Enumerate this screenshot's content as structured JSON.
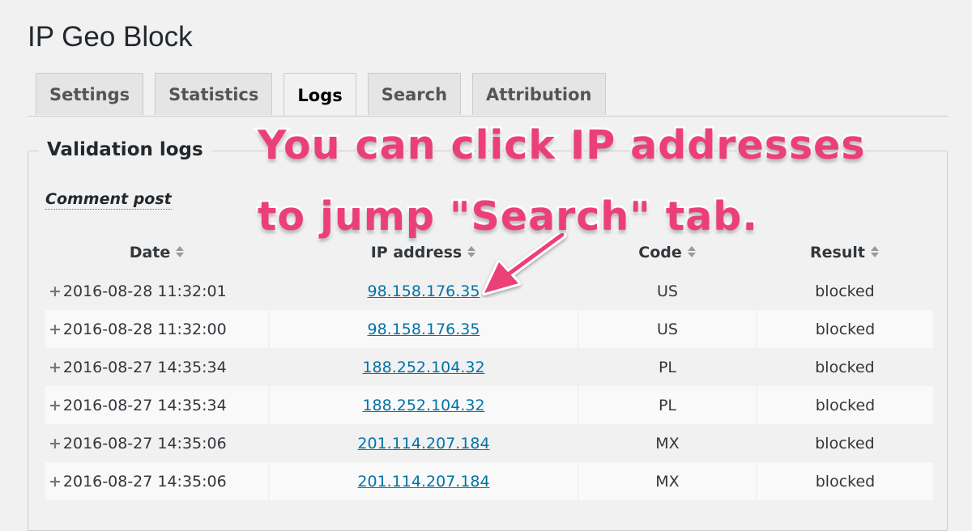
{
  "header": {
    "title": "IP Geo Block"
  },
  "tabs": [
    {
      "label": "Settings",
      "active": false
    },
    {
      "label": "Statistics",
      "active": false
    },
    {
      "label": "Logs",
      "active": true
    },
    {
      "label": "Search",
      "active": false
    },
    {
      "label": "Attribution",
      "active": false
    }
  ],
  "section": {
    "legend": "Validation logs",
    "subhead": "Comment post"
  },
  "table": {
    "columns": [
      "Date",
      "IP address",
      "Code",
      "Result"
    ],
    "rows": [
      {
        "date": "2016-08-28 11:32:01",
        "ip": "98.158.176.35",
        "code": "US",
        "result": "blocked"
      },
      {
        "date": "2016-08-28 11:32:00",
        "ip": "98.158.176.35",
        "code": "US",
        "result": "blocked"
      },
      {
        "date": "2016-08-27 14:35:34",
        "ip": "188.252.104.32",
        "code": "PL",
        "result": "blocked"
      },
      {
        "date": "2016-08-27 14:35:34",
        "ip": "188.252.104.32",
        "code": "PL",
        "result": "blocked"
      },
      {
        "date": "2016-08-27 14:35:06",
        "ip": "201.114.207.184",
        "code": "MX",
        "result": "blocked"
      },
      {
        "date": "2016-08-27 14:35:06",
        "ip": "201.114.207.184",
        "code": "MX",
        "result": "blocked"
      }
    ]
  },
  "annotation": {
    "line1": "You can click IP addresses",
    "line2": "to jump \"Search\" tab.",
    "color": "#ec3f78"
  },
  "colors": {
    "link": "#0073aa",
    "background": "#f1f1f1"
  },
  "icons": {
    "sort": "sort-arrows-icon",
    "expand": "plus-icon",
    "arrow": "pink-arrow-icon"
  }
}
